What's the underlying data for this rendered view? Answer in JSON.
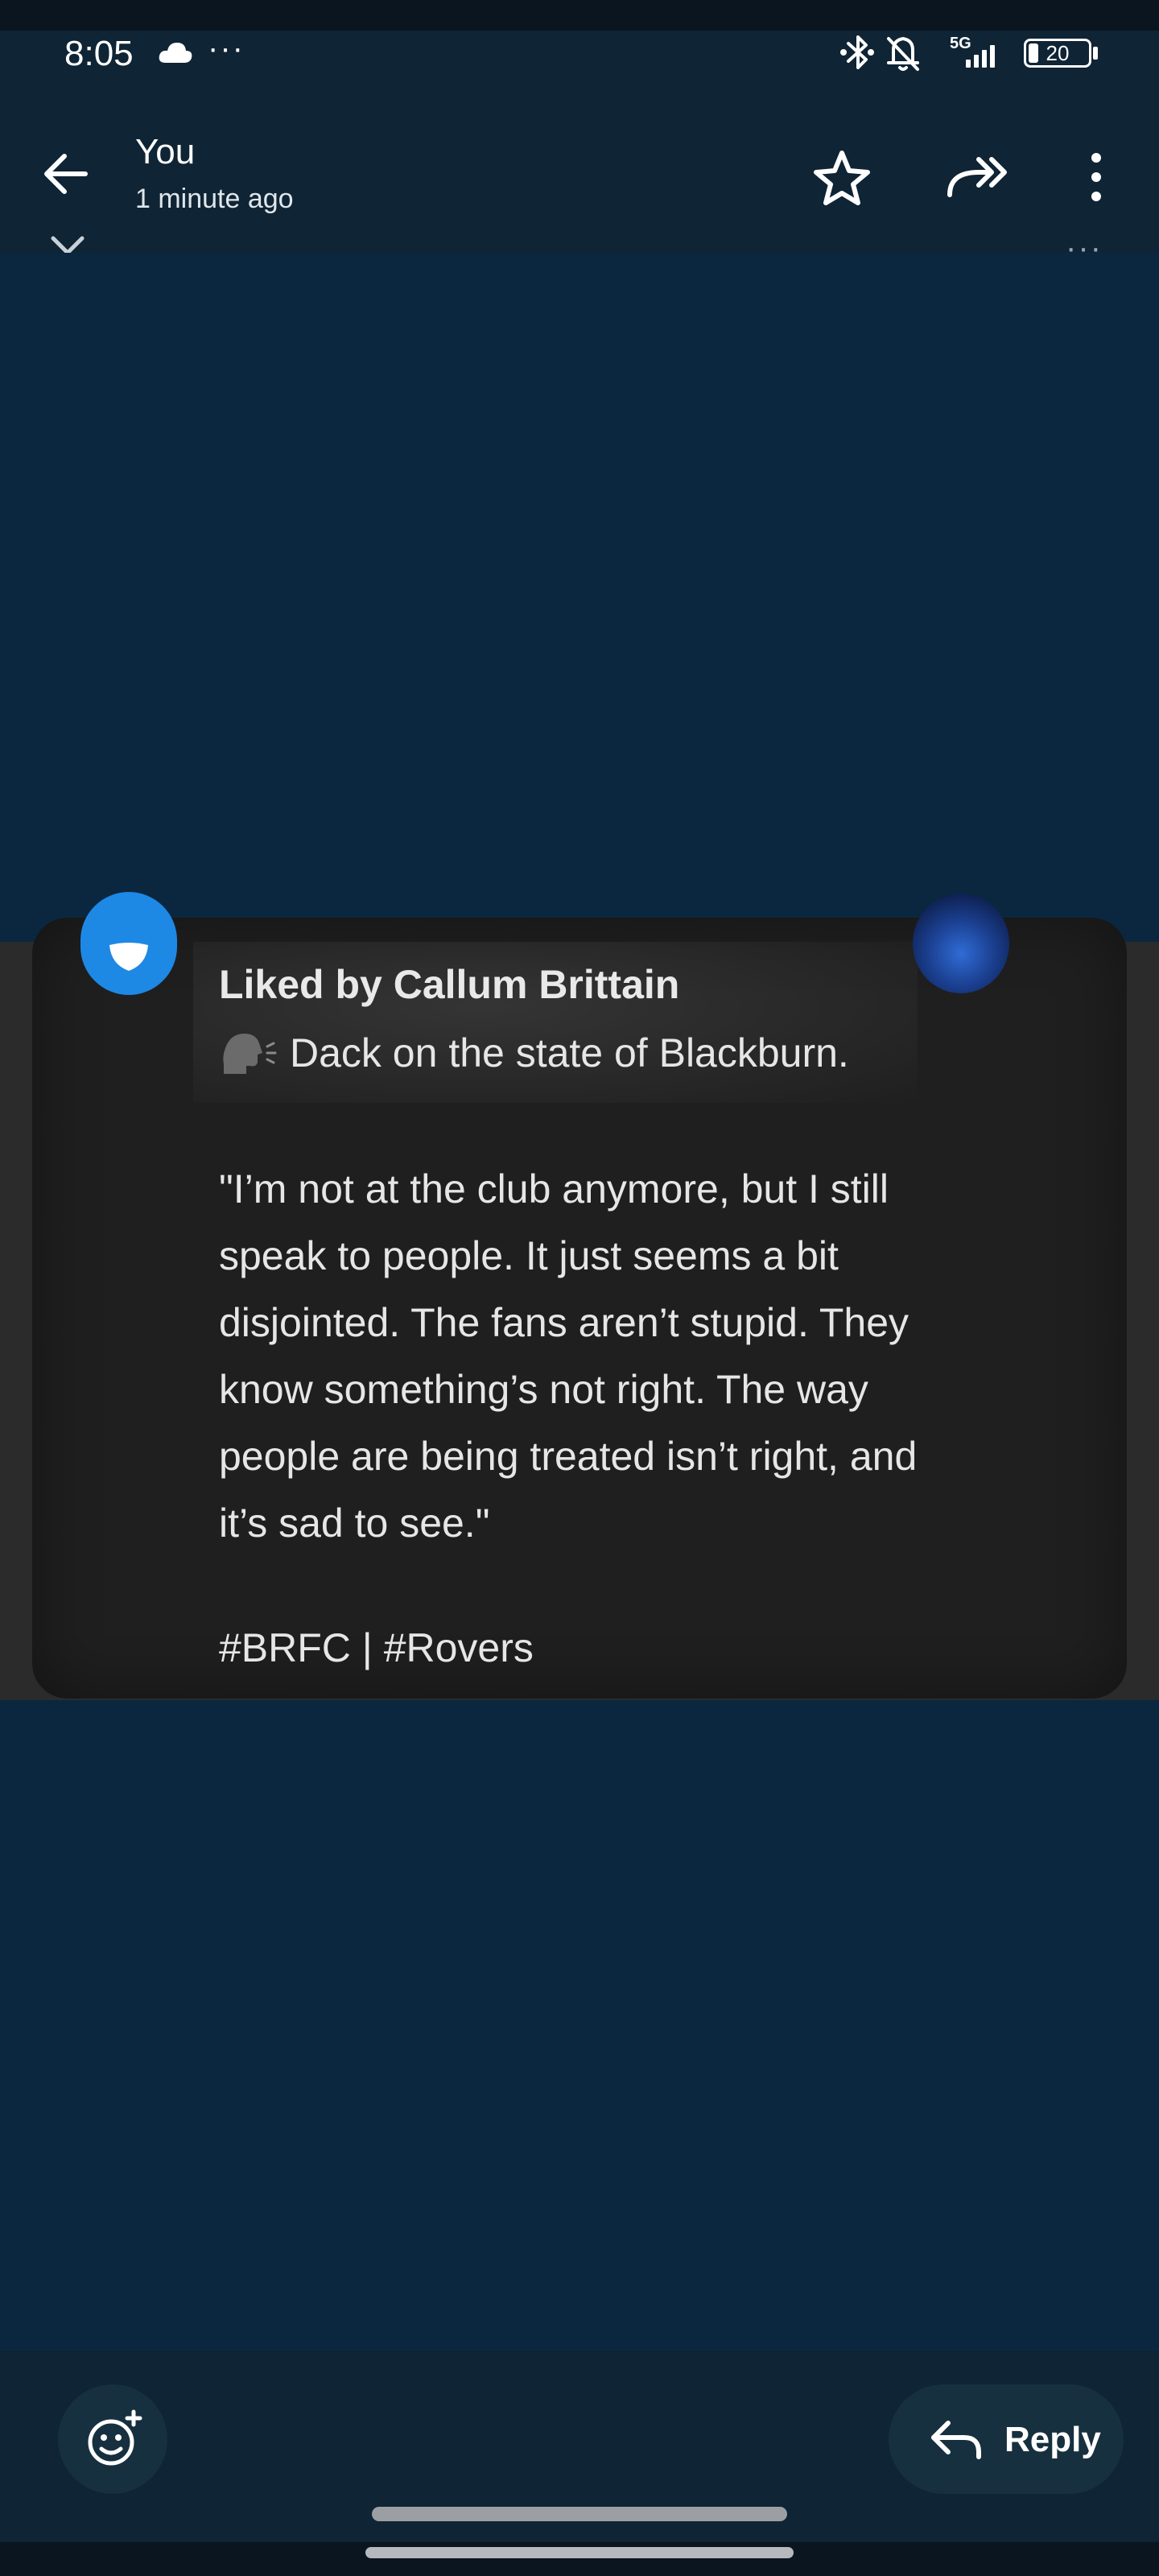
{
  "status_bar": {
    "time": "8:05",
    "overflow_dots": "···",
    "network": "5G",
    "battery": "20",
    "icons": [
      "cloud-icon",
      "bluetooth-icon",
      "bell-off-icon",
      "signal-icon",
      "battery-icon"
    ]
  },
  "header": {
    "sender": "You",
    "timestamp": "1 minute ago",
    "icons": [
      "back-arrow-icon",
      "star-icon",
      "forward-icon",
      "more-vert-icon"
    ]
  },
  "viewer": {
    "overflow_dots": "···",
    "icons": [
      "close-icon"
    ]
  },
  "shared_post": {
    "liked_by": "Liked by Callum Brittain",
    "headline": "Dack on the state of Blackburn.",
    "quote": "\"I’m not at the club anymore, but I still\nspeak to people. It just seems a bit\ndisjointed. The fans aren’t stupid. They\nknow something’s not right. The way\npeople are being treated isn’t right, and\nit’s sad to see.\"",
    "hashtags": "#BRFC | #Rovers",
    "icons": [
      "shield-icon",
      "speaking-head-icon",
      "avatar"
    ]
  },
  "actions": {
    "reply_label": "Reply",
    "icons": [
      "add-reaction-icon",
      "reply-arrow-icon"
    ]
  },
  "colors": {
    "background": "#0b2740",
    "header": "#0f2434",
    "card": "#1f1f1f",
    "badge_blue": "#1e88e5"
  }
}
